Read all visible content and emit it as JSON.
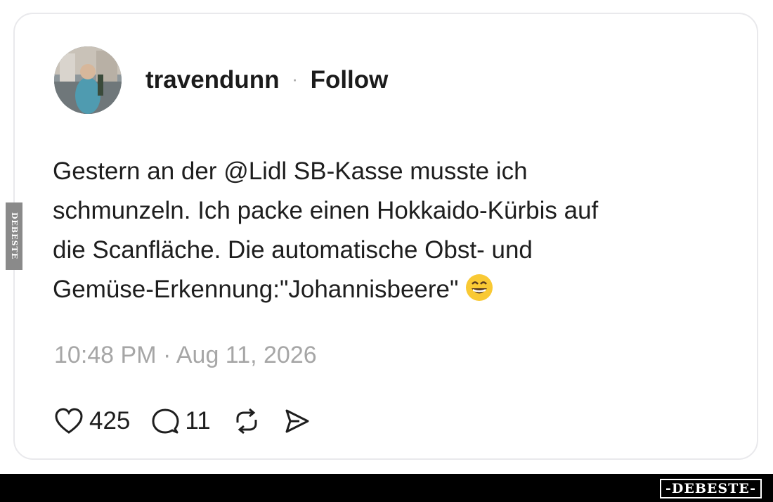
{
  "post": {
    "username": "travendunn",
    "separator": "·",
    "follow_label": "Follow",
    "text_lines": [
      "Gestern an der @Lidl SB-Kasse musste ich",
      "schmunzeln. Ich packe einen Hokkaido-Kürbis auf",
      "die Scanfläche. Die automatische Obst- und",
      "Gemüse-Erkennung:\"Johannisbeere\""
    ],
    "emoji": "grinning-face-with-smiling-eyes",
    "timestamp": "10:48 PM · Aug 11, 2026",
    "likes": "425",
    "comments": "11"
  },
  "icons": {
    "like": "heart-icon",
    "comment": "comment-bubble-icon",
    "repost": "repost-icon",
    "share": "send-icon"
  },
  "watermark": {
    "footer": "-DEBESTE-",
    "side": "DEBESTE"
  },
  "colors": {
    "text": "#1e1e1e",
    "muted": "#a6a6a6",
    "card_border": "#e9e9ec",
    "footer_bg": "#000000"
  }
}
